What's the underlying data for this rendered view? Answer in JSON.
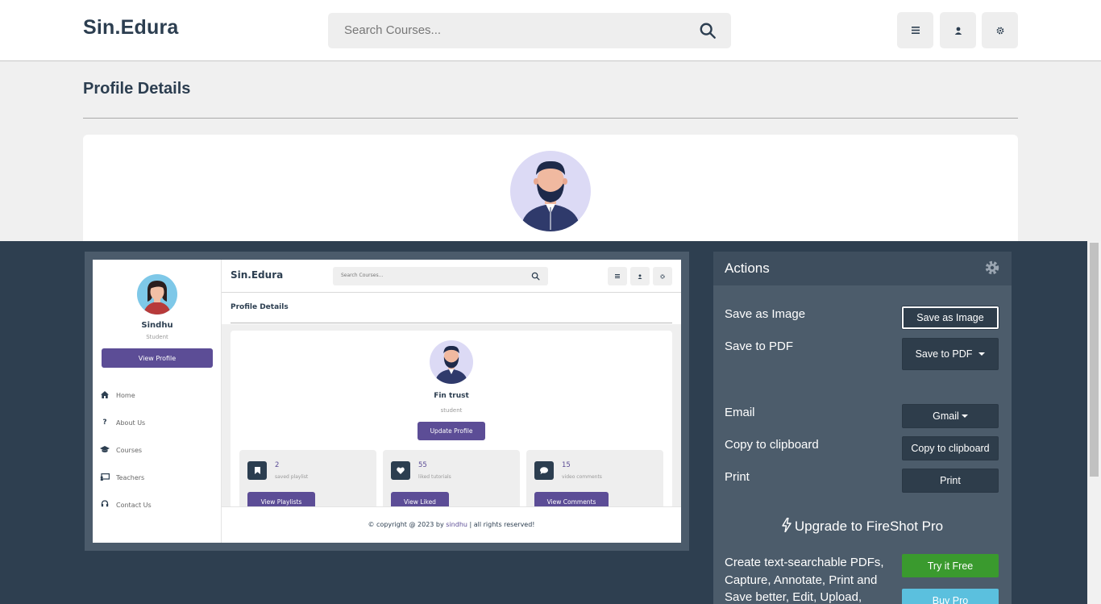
{
  "app": {
    "logo": "Sin.Edura",
    "search_placeholder": "Search Courses...",
    "page_title": "Profile Details",
    "icons": [
      "menu-icon",
      "user-icon",
      "settings-icon",
      "search-icon"
    ]
  },
  "preview": {
    "sidebar": {
      "name": "Sindhu",
      "role": "Student",
      "view_profile": "View Profile",
      "items": [
        {
          "label": "Home",
          "icon": "home-icon"
        },
        {
          "label": "About Us",
          "icon": "question-icon"
        },
        {
          "label": "Courses",
          "icon": "graduation-cap-icon"
        },
        {
          "label": "Teachers",
          "icon": "chalkboard-icon"
        },
        {
          "label": "Contact Us",
          "icon": "headset-icon"
        }
      ]
    },
    "header": {
      "logo": "Sin.Edura",
      "search_placeholder": "Search Courses..."
    },
    "page_title": "Profile Details",
    "profile": {
      "name": "Fin trust",
      "role": "student",
      "update_button": "Update Profile"
    },
    "stats": [
      {
        "number": "2",
        "label": "saved playlist",
        "button": "View Playlists",
        "icon": "bookmark-icon"
      },
      {
        "number": "55",
        "label": "liked tutorials",
        "button": "View Liked",
        "icon": "heart-icon"
      },
      {
        "number": "15",
        "label": "video comments",
        "button": "View Comments",
        "icon": "comment-icon"
      }
    ],
    "footer": {
      "prefix": "© copyright @ 2023 by ",
      "brand": "sindhu",
      "suffix": " | all rights reserved!"
    }
  },
  "actions": {
    "title": "Actions",
    "rows": [
      {
        "label": "Save as Image",
        "button": "Save as Image"
      },
      {
        "label": "Save to PDF",
        "button": "Save to PDF"
      },
      {
        "label": "Email",
        "button": "Gmail"
      },
      {
        "label": "Copy to clipboard",
        "button": "Copy to clipboard"
      },
      {
        "label": "Print",
        "button": "Print"
      }
    ],
    "upgrade": "Upgrade to FireShot Pro",
    "promo": "Create text-searchable PDFs, Capture, Annotate, Print and Save better, Edit, Upload,",
    "try_button": "Try it Free",
    "buy_button": "Buy Pro"
  },
  "colors": {
    "brand": "#5c4d96",
    "dark": "#2c3e50",
    "overlay": "#2e3f50",
    "try": "#3a9a2e",
    "buy": "#5bc0de"
  }
}
